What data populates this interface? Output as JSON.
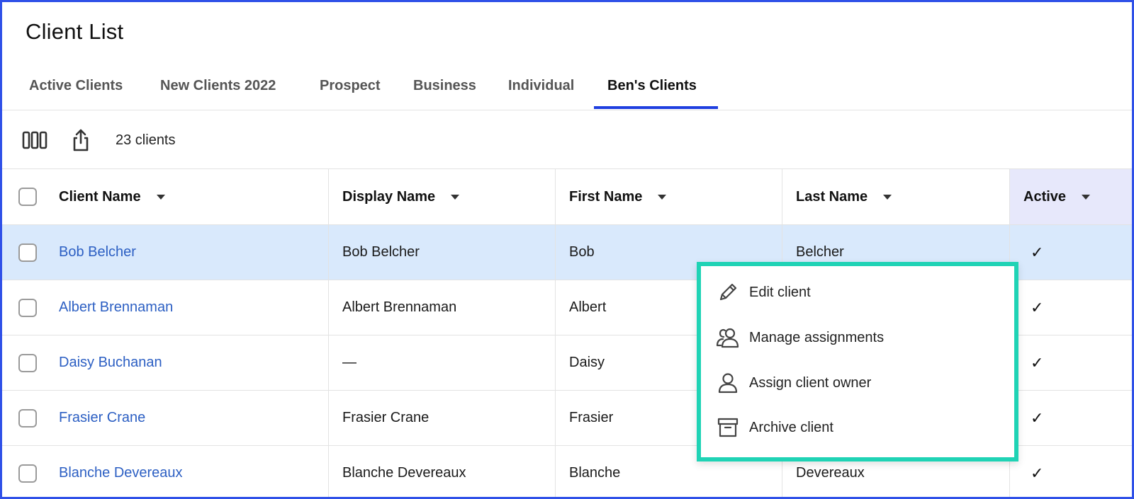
{
  "page": {
    "title": "Client List"
  },
  "tabs": [
    {
      "label": "Active Clients",
      "active": false
    },
    {
      "label": "New Clients 2022",
      "active": false
    },
    {
      "label": "Prospect",
      "active": false
    },
    {
      "label": "Business",
      "active": false
    },
    {
      "label": "Individual",
      "active": false
    },
    {
      "label": "Ben's Clients",
      "active": true
    }
  ],
  "toolbar": {
    "columns_icon": "columns-icon",
    "export_icon": "share-export-icon",
    "count_label": "23 clients"
  },
  "table": {
    "columns": [
      "Client Name",
      "Display Name",
      "First Name",
      "Last Name",
      "Active"
    ],
    "rows": [
      {
        "client_name": "Bob Belcher",
        "display_name": "Bob Belcher",
        "first_name": "Bob",
        "last_name": "Belcher",
        "active": "✓",
        "highlighted": true
      },
      {
        "client_name": "Albert Brennaman",
        "display_name": "Albert Brennaman",
        "first_name": "Albert",
        "last_name": "",
        "active": "✓",
        "highlighted": false
      },
      {
        "client_name": "Daisy Buchanan",
        "display_name": "—",
        "first_name": "Daisy",
        "last_name": "",
        "active": "✓",
        "highlighted": false
      },
      {
        "client_name": "Frasier Crane",
        "display_name": "Frasier Crane",
        "first_name": "Frasier",
        "last_name": "",
        "active": "✓",
        "highlighted": false
      },
      {
        "client_name": "Blanche Devereaux",
        "display_name": "Blanche Devereaux",
        "first_name": "Blanche",
        "last_name": "Devereaux",
        "active": "✓",
        "highlighted": false
      }
    ]
  },
  "context_menu": {
    "items": [
      {
        "label": "Edit client",
        "icon": "pencil-icon"
      },
      {
        "label": "Manage assignments",
        "icon": "users-icon"
      },
      {
        "label": "Assign client owner",
        "icon": "user-icon"
      },
      {
        "label": "Archive client",
        "icon": "archive-icon"
      }
    ]
  },
  "colors": {
    "accent": "#1f3fe0",
    "link": "#2c5fc3",
    "row_highlight": "#d9e9fc",
    "active_header_bg": "#e7e8fb",
    "menu_outline": "#1fd3b5",
    "frame_border": "#2f50e8"
  }
}
